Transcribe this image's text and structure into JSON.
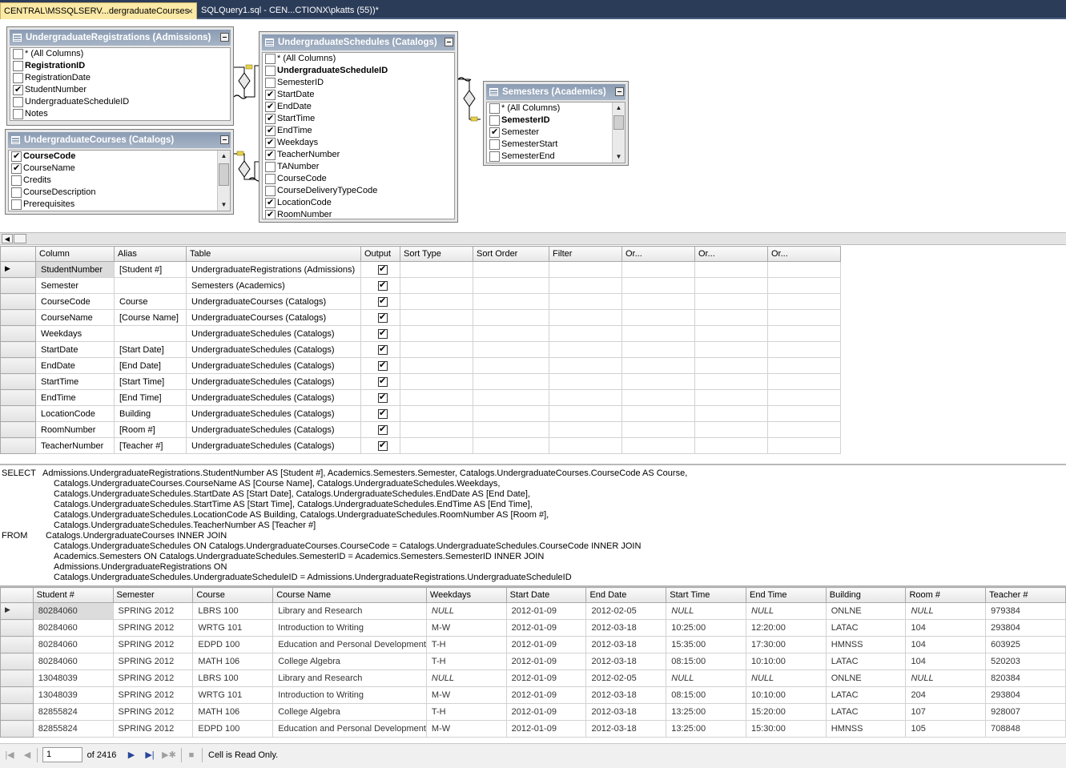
{
  "tabs": [
    {
      "label": "CENTRAL\\MSSQLSERV...dergraduateCourses",
      "close": "×"
    },
    {
      "label": "SQLQuery1.sql - CEN...CTIONX\\pkatts (55))*"
    }
  ],
  "diagram": {
    "tables": [
      {
        "title": "UndergraduateRegistrations (Admissions)",
        "columns": [
          {
            "name": "* (All Columns)",
            "checked": false,
            "key": false
          },
          {
            "name": "RegistrationID",
            "checked": false,
            "key": true
          },
          {
            "name": "RegistrationDate",
            "checked": false,
            "key": false
          },
          {
            "name": "StudentNumber",
            "checked": true,
            "key": false
          },
          {
            "name": "UndergraduateScheduleID",
            "checked": false,
            "key": false
          },
          {
            "name": "Notes",
            "checked": false,
            "key": false
          }
        ]
      },
      {
        "title": "UndergraduateCourses (Catalogs)",
        "columns": [
          {
            "name": "CourseCode",
            "checked": true,
            "key": true
          },
          {
            "name": "CourseName",
            "checked": true,
            "key": false
          },
          {
            "name": "Credits",
            "checked": false,
            "key": false
          },
          {
            "name": "CourseDescription",
            "checked": false,
            "key": false
          },
          {
            "name": "Prerequisites",
            "checked": false,
            "key": false
          }
        ]
      },
      {
        "title": "UndergraduateSchedules (Catalogs)",
        "columns": [
          {
            "name": "* (All Columns)",
            "checked": false,
            "key": false
          },
          {
            "name": "UndergraduateScheduleID",
            "checked": false,
            "key": true
          },
          {
            "name": "SemesterID",
            "checked": false,
            "key": false
          },
          {
            "name": "StartDate",
            "checked": true,
            "key": false
          },
          {
            "name": "EndDate",
            "checked": true,
            "key": false
          },
          {
            "name": "StartTime",
            "checked": true,
            "key": false
          },
          {
            "name": "EndTime",
            "checked": true,
            "key": false
          },
          {
            "name": "Weekdays",
            "checked": true,
            "key": false
          },
          {
            "name": "TeacherNumber",
            "checked": true,
            "key": false
          },
          {
            "name": "TANumber",
            "checked": false,
            "key": false
          },
          {
            "name": "CourseCode",
            "checked": false,
            "key": false
          },
          {
            "name": "CourseDeliveryTypeCode",
            "checked": false,
            "key": false
          },
          {
            "name": "LocationCode",
            "checked": true,
            "key": false
          },
          {
            "name": "RoomNumber",
            "checked": true,
            "key": false
          }
        ]
      },
      {
        "title": "Semesters (Academics)",
        "columns": [
          {
            "name": "* (All Columns)",
            "checked": false,
            "key": false
          },
          {
            "name": "SemesterID",
            "checked": false,
            "key": true
          },
          {
            "name": "Semester",
            "checked": true,
            "key": false
          },
          {
            "name": "SemesterStart",
            "checked": false,
            "key": false
          },
          {
            "name": "SemesterEnd",
            "checked": false,
            "key": false
          }
        ]
      }
    ]
  },
  "criteria": {
    "headers": [
      "Column",
      "Alias",
      "Table",
      "Output",
      "Sort Type",
      "Sort Order",
      "Filter",
      "Or...",
      "Or...",
      "Or..."
    ],
    "rows": [
      {
        "column": "StudentNumber",
        "alias": "[Student #]",
        "table": "UndergraduateRegistrations (Admissions)",
        "output": true
      },
      {
        "column": "Semester",
        "alias": "",
        "table": "Semesters (Academics)",
        "output": true
      },
      {
        "column": "CourseCode",
        "alias": "Course",
        "table": "UndergraduateCourses (Catalogs)",
        "output": true
      },
      {
        "column": "CourseName",
        "alias": "[Course Name]",
        "table": "UndergraduateCourses (Catalogs)",
        "output": true
      },
      {
        "column": "Weekdays",
        "alias": "",
        "table": "UndergraduateSchedules (Catalogs)",
        "output": true
      },
      {
        "column": "StartDate",
        "alias": "[Start Date]",
        "table": "UndergraduateSchedules (Catalogs)",
        "output": true
      },
      {
        "column": "EndDate",
        "alias": "[End Date]",
        "table": "UndergraduateSchedules (Catalogs)",
        "output": true
      },
      {
        "column": "StartTime",
        "alias": "[Start Time]",
        "table": "UndergraduateSchedules (Catalogs)",
        "output": true
      },
      {
        "column": "EndTime",
        "alias": "[End Time]",
        "table": "UndergraduateSchedules (Catalogs)",
        "output": true
      },
      {
        "column": "LocationCode",
        "alias": "Building",
        "table": "UndergraduateSchedules (Catalogs)",
        "output": true
      },
      {
        "column": "RoomNumber",
        "alias": "[Room #]",
        "table": "UndergraduateSchedules (Catalogs)",
        "output": true
      },
      {
        "column": "TeacherNumber",
        "alias": "[Teacher #]",
        "table": "UndergraduateSchedules (Catalogs)",
        "output": true
      }
    ]
  },
  "sql": {
    "select_kw": "SELECT",
    "from_kw": "FROM",
    "select_lines": [
      "Admissions.UndergraduateRegistrations.StudentNumber AS [Student #], Academics.Semesters.Semester, Catalogs.UndergraduateCourses.CourseCode AS Course,",
      "Catalogs.UndergraduateCourses.CourseName AS [Course Name], Catalogs.UndergraduateSchedules.Weekdays,",
      "Catalogs.UndergraduateSchedules.StartDate AS [Start Date], Catalogs.UndergraduateSchedules.EndDate AS [End Date],",
      "Catalogs.UndergraduateSchedules.StartTime AS [Start Time], Catalogs.UndergraduateSchedules.EndTime AS [End Time],",
      "Catalogs.UndergraduateSchedules.LocationCode AS Building, Catalogs.UndergraduateSchedules.RoomNumber AS [Room #],",
      "Catalogs.UndergraduateSchedules.TeacherNumber AS [Teacher #]"
    ],
    "from_lines": [
      "Catalogs.UndergraduateCourses INNER JOIN",
      "Catalogs.UndergraduateSchedules ON Catalogs.UndergraduateCourses.CourseCode = Catalogs.UndergraduateSchedules.CourseCode INNER JOIN",
      "Academics.Semesters ON Catalogs.UndergraduateSchedules.SemesterID = Academics.Semesters.SemesterID INNER JOIN",
      "Admissions.UndergraduateRegistrations ON",
      "Catalogs.UndergraduateSchedules.UndergraduateScheduleID = Admissions.UndergraduateRegistrations.UndergraduateScheduleID"
    ]
  },
  "results": {
    "headers": [
      "Student #",
      "Semester",
      "Course",
      "Course Name",
      "Weekdays",
      "Start Date",
      "End Date",
      "Start Time",
      "End Time",
      "Building",
      "Room #",
      "Teacher #"
    ],
    "rows": [
      [
        "80284060",
        "SPRING 2012",
        "LBRS 100",
        "Library and Research",
        "NULL",
        "2012-01-09",
        "2012-02-05",
        "NULL",
        "NULL",
        "ONLNE",
        "NULL",
        "979384"
      ],
      [
        "80284060",
        "SPRING 2012",
        "WRTG 101",
        "Introduction to Writing",
        "M-W",
        "2012-01-09",
        "2012-03-18",
        "10:25:00",
        "12:20:00",
        "LATAC",
        "104",
        "293804"
      ],
      [
        "80284060",
        "SPRING 2012",
        "EDPD 100",
        "Education and Personal Development",
        "T-H",
        "2012-01-09",
        "2012-03-18",
        "15:35:00",
        "17:30:00",
        "HMNSS",
        "104",
        "603925"
      ],
      [
        "80284060",
        "SPRING 2012",
        "MATH 106",
        "College Algebra",
        "T-H",
        "2012-01-09",
        "2012-03-18",
        "08:15:00",
        "10:10:00",
        "LATAC",
        "104",
        "520203"
      ],
      [
        "13048039",
        "SPRING 2012",
        "LBRS 100",
        "Library and Research",
        "NULL",
        "2012-01-09",
        "2012-02-05",
        "NULL",
        "NULL",
        "ONLNE",
        "NULL",
        "820384"
      ],
      [
        "13048039",
        "SPRING 2012",
        "WRTG 101",
        "Introduction to Writing",
        "M-W",
        "2012-01-09",
        "2012-03-18",
        "08:15:00",
        "10:10:00",
        "LATAC",
        "204",
        "293804"
      ],
      [
        "82855824",
        "SPRING 2012",
        "MATH 106",
        "College Algebra",
        "T-H",
        "2012-01-09",
        "2012-03-18",
        "13:25:00",
        "15:20:00",
        "LATAC",
        "107",
        "928007"
      ],
      [
        "82855824",
        "SPRING 2012",
        "EDPD 100",
        "Education and Personal Development",
        "M-W",
        "2012-01-09",
        "2012-03-18",
        "13:25:00",
        "15:30:00",
        "HMNSS",
        "105",
        "708848"
      ]
    ]
  },
  "nav": {
    "record": "1",
    "of_total": "of 2416",
    "status": "Cell is Read Only."
  }
}
